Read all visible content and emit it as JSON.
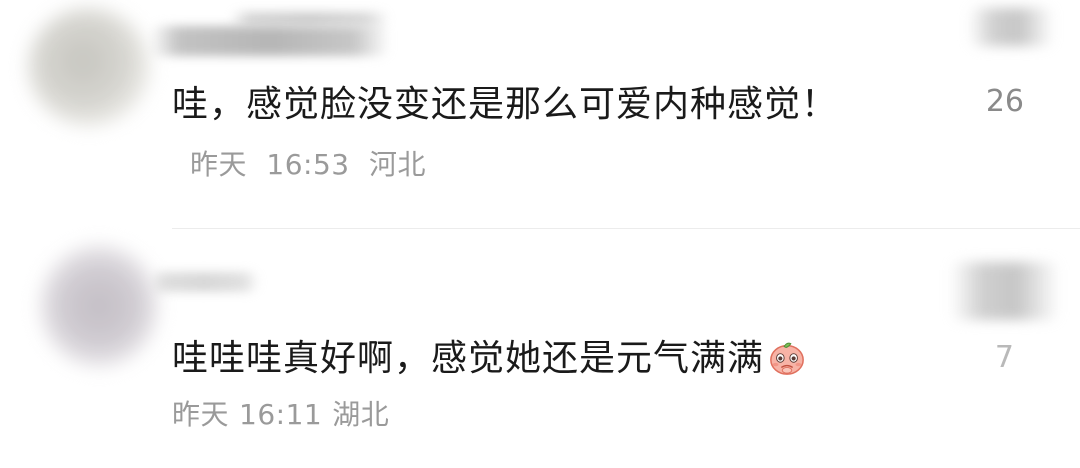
{
  "comments": [
    {
      "text": "哇，感觉脸没变还是那么可爱内种感觉！",
      "time_label": "昨天",
      "time": "16:53",
      "location": "河北",
      "like_count": "26",
      "emoji": ""
    },
    {
      "text": "哇哇哇真好啊，感觉她还是元气满满",
      "time_label": "昨天",
      "time": "16:11",
      "location": "湖北",
      "like_count": "7",
      "emoji": "peach-emoji-icon"
    }
  ],
  "colors": {
    "text": "#1a1a1a",
    "meta": "#9a9a9a",
    "like_count": "#8a8a8a",
    "divider": "#ececec"
  }
}
